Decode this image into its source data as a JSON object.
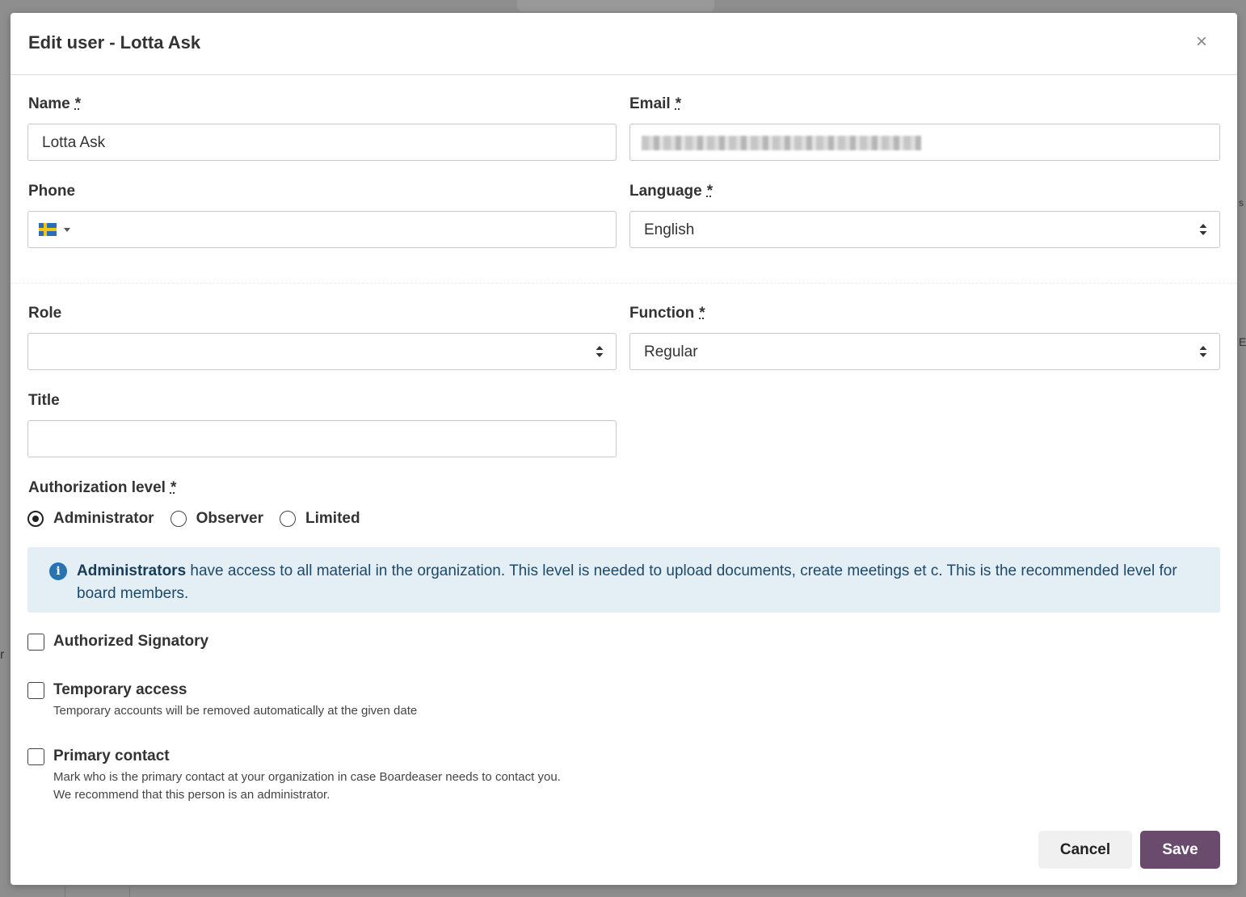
{
  "modal": {
    "title": "Edit user - Lotta Ask",
    "close_symbol": "×"
  },
  "fields": {
    "name": {
      "label": "Name",
      "required_mark": "*",
      "value": "Lotta Ask"
    },
    "email": {
      "label": "Email",
      "required_mark": "*",
      "value_obscured": true
    },
    "phone": {
      "label": "Phone",
      "country_flag": "sweden-flag-icon",
      "value": ""
    },
    "language": {
      "label": "Language",
      "required_mark": "*",
      "value": "English"
    },
    "role": {
      "label": "Role",
      "value": ""
    },
    "function": {
      "label": "Function",
      "required_mark": "*",
      "value": "Regular"
    },
    "title": {
      "label": "Title",
      "value": ""
    }
  },
  "authorization": {
    "label": "Authorization level",
    "required_mark": "*",
    "options": [
      "Administrator",
      "Observer",
      "Limited"
    ],
    "selected": "Administrator",
    "info_strong": "Administrators",
    "info_text": " have access to all material in the organization. This level is needed to upload documents, create meetings et c. This is the recommended level for board members."
  },
  "checkboxes": {
    "authorized_signatory": {
      "label": "Authorized Signatory",
      "checked": false
    },
    "temporary_access": {
      "label": "Temporary access",
      "help": "Temporary accounts will be removed automatically at the given date",
      "checked": false
    },
    "primary_contact": {
      "label": "Primary contact",
      "help_line1": "Mark who is the primary contact at your organization in case Boardeaser needs to contact you.",
      "help_line2": "We recommend that this person is an administrator.",
      "checked": false
    }
  },
  "buttons": {
    "cancel": "Cancel",
    "save": "Save"
  },
  "colors": {
    "save_button": "#6b4b6d",
    "info_background": "#e3eef5",
    "info_icon": "#2874b3",
    "backdrop": "#8e8e8e"
  },
  "background": {
    "edge_text_right_1": "s",
    "edge_text_right_2": "E",
    "edge_text_left": "r"
  }
}
